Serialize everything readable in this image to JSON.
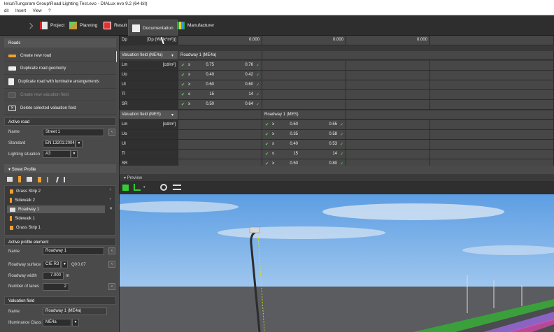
{
  "window": {
    "title": "lelca\\Tungsram Group\\Road Lighting Test.evo - DIALux evo 9.2  (64-bit)"
  },
  "menu": [
    "dit",
    "Insert",
    "View",
    "?"
  ],
  "toolbar": {
    "tabs": [
      {
        "label": "Project"
      },
      {
        "label": "Planning"
      },
      {
        "label": "Result"
      },
      {
        "label": "Documentation"
      },
      {
        "label": "Manufacturer"
      }
    ]
  },
  "roads": {
    "header": "Roads",
    "actions": [
      "Create new road",
      "Duplicate road geometry",
      "Duplicate road with luminaire arrangements",
      "Create new valuation field",
      "Delete selected valuation field"
    ]
  },
  "active_road": {
    "header": "Active road",
    "name_label": "Name",
    "name_value": "Street 1",
    "standard_label": "Standard",
    "standard_value": "EN 13201:2004",
    "lighting_label": "Lighting situation",
    "lighting_value": "A3"
  },
  "street_profile": {
    "header": "Street Profile",
    "items": [
      "Grass Strip 2",
      "Sidewalk 2",
      "Roadway 1",
      "Sidewalk 1",
      "Grass Strip 1"
    ],
    "selected": "Roadway 1"
  },
  "active_profile": {
    "header": "Active profile element",
    "name_label": "Name",
    "name_value": "Roadway 1",
    "surface_label": "Roadway surface",
    "surface_value": "CIE R3",
    "q0_label": "Q0",
    "q0_value": "0.07",
    "width_label": "Roadway width",
    "width_value": "7.000",
    "width_unit": "m",
    "lanes_label": "Number of lanes",
    "lanes_value": "2"
  },
  "valuation_field": {
    "header": "Valuation field",
    "name_label": "Name",
    "name_value": "Roadway 1 (ME4a)",
    "class_label": "Illuminance Class",
    "class_value": "ME4a"
  },
  "table": {
    "dp_label": "Dp",
    "dp_unit": "[Dp (W/(lx*m²))]",
    "dp_values": [
      "0.000",
      "0.000",
      "0.000"
    ],
    "me_header": "Valuation field (ME4a)",
    "me_field": "Roadway 1 (ME4a)",
    "me_rows": [
      {
        "label": "Lm",
        "unit": "[cd/m²]",
        "op": "≥",
        "target": "0.75",
        "value": "0.76"
      },
      {
        "label": "Uo",
        "unit": "",
        "op": "≥",
        "target": "0.40",
        "value": "0.42"
      },
      {
        "label": "Ul",
        "unit": "",
        "op": "≥",
        "target": "0.60",
        "value": "0.60"
      },
      {
        "label": "TI",
        "unit": "",
        "op": "≤",
        "target": "15",
        "value": "14"
      },
      {
        "label": "SR",
        "unit": "",
        "op": "≥",
        "target": "0.50",
        "value": "0.64"
      }
    ],
    "mes_header": "Valuation field (MES)",
    "mes_field": "Roadway 1 (MES)",
    "mes_rows": [
      {
        "label": "Lm",
        "unit": "[cd/m²]",
        "op": "≥",
        "target": "0.50",
        "value": "0.55"
      },
      {
        "label": "Uo",
        "unit": "",
        "op": "≥",
        "target": "0.35",
        "value": "0.58"
      },
      {
        "label": "Ul",
        "unit": "",
        "op": "≥",
        "target": "0.40",
        "value": "0.53"
      },
      {
        "label": "TI",
        "unit": "",
        "op": "≤",
        "target": "15",
        "value": "14"
      },
      {
        "label": "SR",
        "unit": "",
        "op": "≥",
        "target": "0.50",
        "value": "0.80"
      }
    ]
  },
  "preview": {
    "header": "Preview"
  },
  "colors": {
    "accent_green": "#6cd36c",
    "icon_orange": "#f0a030",
    "selected_row": "#5a5a5a"
  }
}
